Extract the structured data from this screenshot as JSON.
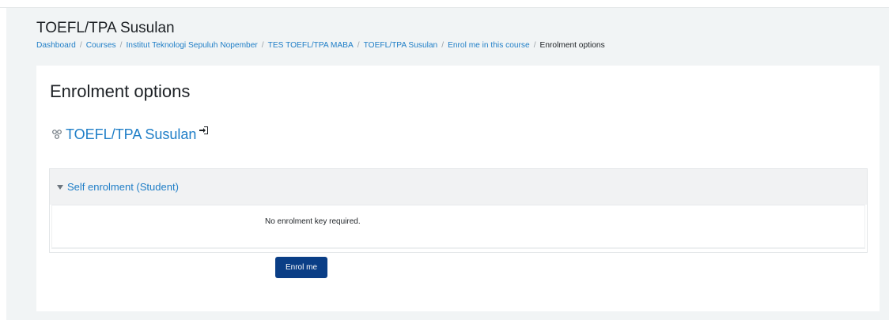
{
  "header": {
    "title": "TOEFL/TPA Susulan",
    "breadcrumb": [
      "Dashboard",
      "Courses",
      "Institut Teknologi Sepuluh Nopember",
      "TES TOEFL/TPA MABA",
      "TOEFL/TPA Susulan",
      "Enrol me in this course"
    ],
    "breadcrumb_current": "Enrolment options",
    "breadcrumb_separator": "/"
  },
  "main": {
    "heading": "Enrolment options",
    "course": {
      "name": "TOEFL/TPA Susulan",
      "icon": "course-icon",
      "enrol_icon": "sign-in-icon"
    },
    "enrol_section": {
      "title": "Self enrolment (Student)",
      "message": "No enrolment key required.",
      "button_label": "Enrol me"
    }
  },
  "colors": {
    "link": "#1f7ec7",
    "button": "#0a3e86",
    "page_background": "#f1f4f5"
  }
}
